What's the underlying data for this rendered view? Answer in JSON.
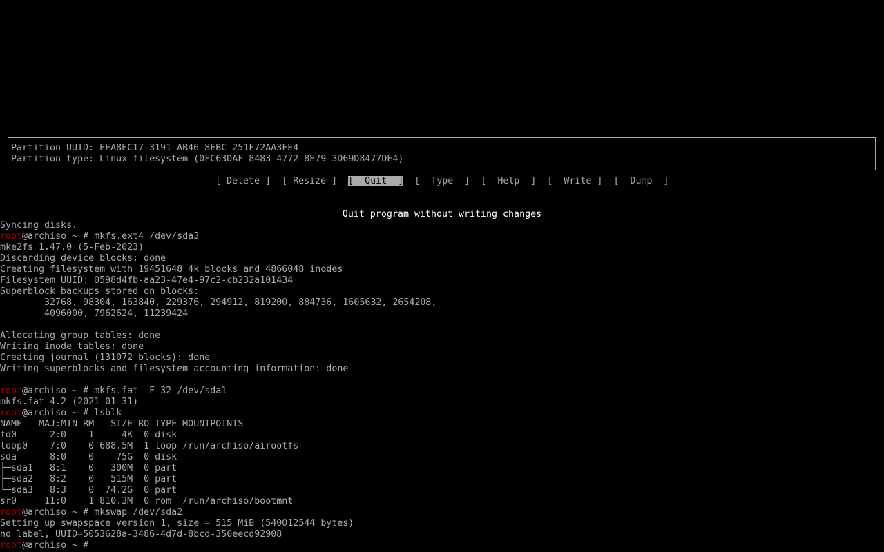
{
  "info": {
    "partition_uuid": "Partition UUID: EEA8EC17-3191-AB46-8EBC-251F72AA3FE4",
    "partition_type": "Partition type: Linux filesystem (0FC63DAF-8483-4772-8E79-3D69D8477DE4)"
  },
  "menu": {
    "items": [
      {
        "label": "[ Delete ]"
      },
      {
        "label": "[ Resize ]"
      },
      {
        "label": "[  Quit  ]"
      },
      {
        "label": "[  Type  ]"
      },
      {
        "label": "[  Help  ]"
      },
      {
        "label": "[  Write ]"
      },
      {
        "label": "[  Dump  ]"
      }
    ],
    "selected_index": 2
  },
  "status_message": "Quit program without writing changes",
  "prompt": {
    "user": "root",
    "host_suffix": "@archiso ~ # "
  },
  "terminal": [
    {
      "type": "out",
      "text": "Syncing disks."
    },
    {
      "type": "cmd",
      "cmd": "mkfs.ext4 /dev/sda3"
    },
    {
      "type": "out",
      "text": "mke2fs 1.47.0 (5-Feb-2023)"
    },
    {
      "type": "out",
      "text": "Discarding device blocks: done"
    },
    {
      "type": "out",
      "text": "Creating filesystem with 19451648 4k blocks and 4866048 inodes"
    },
    {
      "type": "out",
      "text": "Filesystem UUID: 0598d4fb-aa23-47e4-97c2-cb232a101434"
    },
    {
      "type": "out",
      "text": "Superblock backups stored on blocks:"
    },
    {
      "type": "out",
      "text": "        32768, 98304, 163840, 229376, 294912, 819200, 884736, 1605632, 2654208,"
    },
    {
      "type": "out",
      "text": "        4096000, 7962624, 11239424"
    },
    {
      "type": "out",
      "text": ""
    },
    {
      "type": "out",
      "text": "Allocating group tables: done"
    },
    {
      "type": "out",
      "text": "Writing inode tables: done"
    },
    {
      "type": "out",
      "text": "Creating journal (131072 blocks): done"
    },
    {
      "type": "out",
      "text": "Writing superblocks and filesystem accounting information: done"
    },
    {
      "type": "out",
      "text": ""
    },
    {
      "type": "cmd",
      "cmd": "mkfs.fat -F 32 /dev/sda1"
    },
    {
      "type": "out",
      "text": "mkfs.fat 4.2 (2021-01-31)"
    },
    {
      "type": "cmd",
      "cmd": "lsblk"
    },
    {
      "type": "out",
      "text": "NAME   MAJ:MIN RM   SIZE RO TYPE MOUNTPOINTS"
    },
    {
      "type": "out",
      "text": "fd0      2:0    1     4K  0 disk"
    },
    {
      "type": "out",
      "text": "loop0    7:0    0 688.5M  1 loop /run/archiso/airootfs"
    },
    {
      "type": "out",
      "text": "sda      8:0    0    75G  0 disk"
    },
    {
      "type": "out",
      "text": "├─sda1   8:1    0   300M  0 part"
    },
    {
      "type": "out",
      "text": "├─sda2   8:2    0   515M  0 part"
    },
    {
      "type": "out",
      "text": "└─sda3   8:3    0  74.2G  0 part"
    },
    {
      "type": "out",
      "text": "sr0     11:0    1 810.3M  0 rom  /run/archiso/bootmnt"
    },
    {
      "type": "cmd",
      "cmd": "mkswap /dev/sda2"
    },
    {
      "type": "out",
      "text": "Setting up swapspace version 1, size = 515 MiB (540012544 bytes)"
    },
    {
      "type": "out",
      "text": "no label, UUID=5053628a-3486-4d7d-8bcd-350eecd92908"
    },
    {
      "type": "cmd",
      "cmd": ""
    }
  ]
}
